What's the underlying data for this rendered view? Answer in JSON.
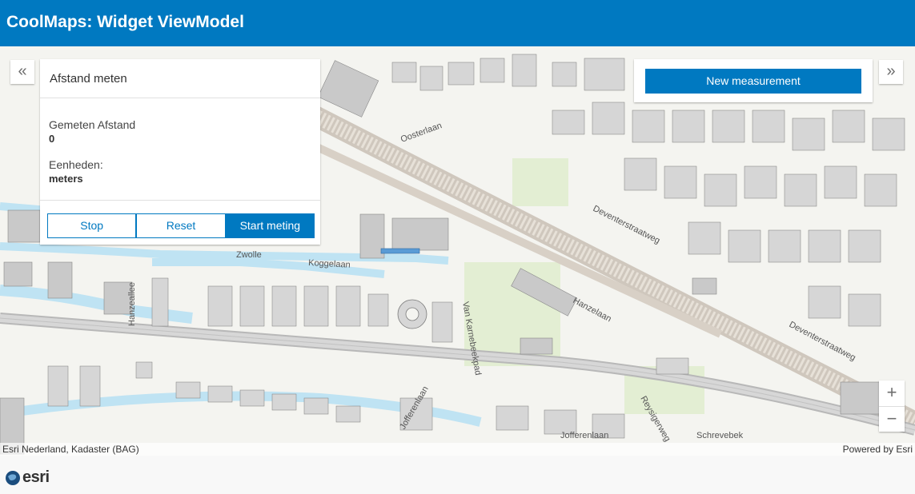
{
  "header": {
    "title": "CoolMaps: Widget ViewModel"
  },
  "left_panel": {
    "collapse_icon": "double-chevron-left-icon",
    "title": "Afstand meten",
    "distance_label": "Gemeten Afstand",
    "distance_value": "0",
    "units_label": "Eenheden:",
    "units_value": "meters",
    "buttons": {
      "stop": "Stop",
      "reset": "Reset",
      "start": "Start meting"
    }
  },
  "right_panel": {
    "collapse_icon": "double-chevron-right-icon",
    "new_measurement": "New measurement"
  },
  "map": {
    "street_labels": [
      "Oosterlaan",
      "Deventerstraatweg",
      "Zwolle",
      "Koggelaan",
      "Hanzelaan",
      "Hanzeallee",
      "Van Karnebeekpad",
      "Deventerstraatweg",
      "Jofferenlaan",
      "Jofferenlaan",
      "Reysigerweg",
      "Schrevebek"
    ],
    "attribution": "Esri Nederland, Kadaster (BAG)",
    "powered_by": "Powered by Esri",
    "zoom_in": "+",
    "zoom_out": "−"
  },
  "footer": {
    "logo_text": "esri"
  }
}
